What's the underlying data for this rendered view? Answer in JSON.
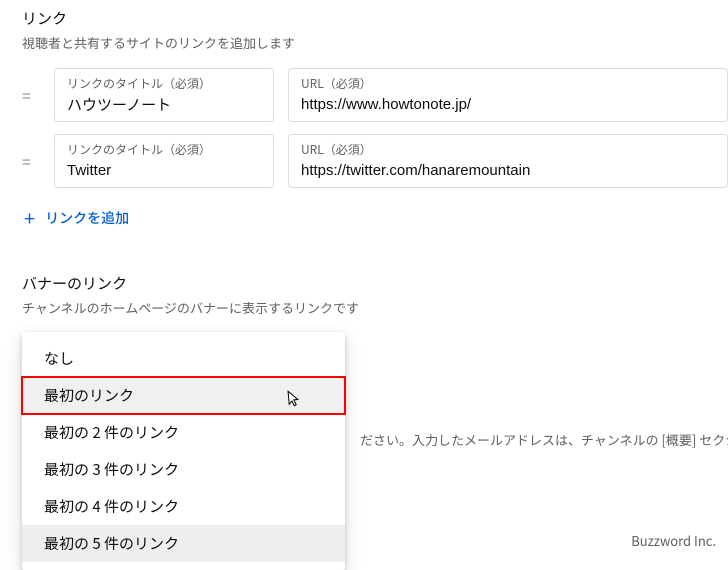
{
  "links_section": {
    "title": "リンク",
    "subtitle": "視聴者と共有するサイトのリンクを追加します",
    "title_field_label": "リンクのタイトル（必須）",
    "url_field_label": "URL（必須）",
    "rows": [
      {
        "title": "ハウツーノート",
        "url": "https://www.howtonote.jp/"
      },
      {
        "title": "Twitter",
        "url": "https://twitter.com/hanaremountain"
      }
    ],
    "add_label": "リンクを追加"
  },
  "banner_section": {
    "title": "バナーのリンク",
    "subtitle": "チャンネルのホームページのバナーに表示するリンクです"
  },
  "dropdown": {
    "options": [
      "なし",
      "最初のリンク",
      "最初の 2 件のリンク",
      "最初の 3 件のリンク",
      "最初の 4 件のリンク",
      "最初の 5 件のリンク"
    ],
    "hovered_index": 1,
    "selected_index": 5
  },
  "background_hint": "ださい。入力したメールアドレスは、チャンネルの [概要] セクショ",
  "footer": "Buzzword Inc."
}
